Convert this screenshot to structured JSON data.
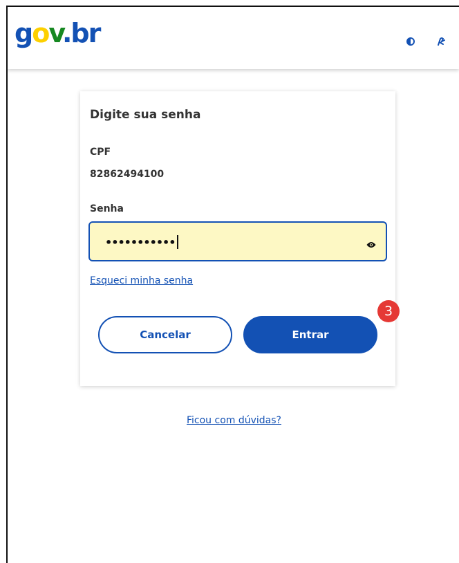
{
  "header": {
    "logo": {
      "g": "g",
      "o": "o",
      "v": "v",
      "dot": ".",
      "br": "br"
    },
    "icons": [
      "contrast-icon",
      "vlibras-icon"
    ]
  },
  "card": {
    "title": "Digite sua senha",
    "cpf_label": "CPF",
    "cpf_value": "82862494100",
    "password_label": "Senha",
    "password_value": "•••••••••••",
    "forgot_link": "Esqueci minha senha",
    "cancel_button": "Cancelar",
    "enter_button": "Entrar",
    "step_badge": "3"
  },
  "help_link": "Ficou com dúvidas?",
  "colors": {
    "primary": "#1351b4",
    "input_highlight": "#fdf8c4",
    "badge": "#e53935"
  }
}
